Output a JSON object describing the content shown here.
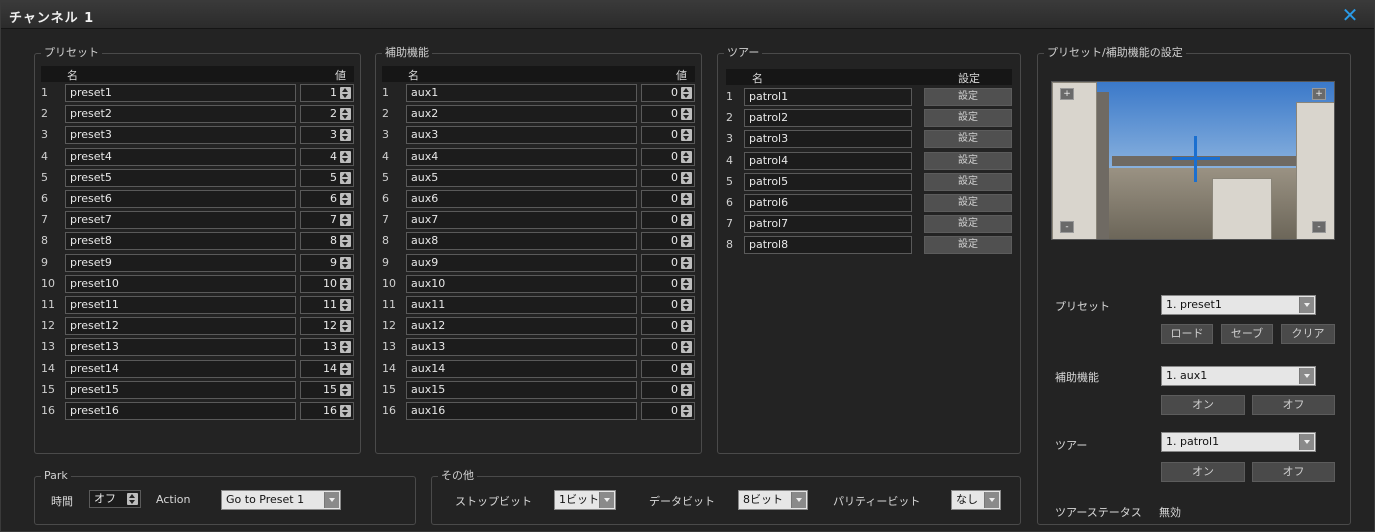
{
  "window": {
    "title": "チャンネル 1"
  },
  "preset_group": {
    "title": "プリセット",
    "header_name": "名",
    "header_value": "値",
    "rows": [
      {
        "num": "1",
        "name": "preset1",
        "value": "1"
      },
      {
        "num": "2",
        "name": "preset2",
        "value": "2"
      },
      {
        "num": "3",
        "name": "preset3",
        "value": "3"
      },
      {
        "num": "4",
        "name": "preset4",
        "value": "4"
      },
      {
        "num": "5",
        "name": "preset5",
        "value": "5"
      },
      {
        "num": "6",
        "name": "preset6",
        "value": "6"
      },
      {
        "num": "7",
        "name": "preset7",
        "value": "7"
      },
      {
        "num": "8",
        "name": "preset8",
        "value": "8"
      },
      {
        "num": "9",
        "name": "preset9",
        "value": "9"
      },
      {
        "num": "10",
        "name": "preset10",
        "value": "10"
      },
      {
        "num": "11",
        "name": "preset11",
        "value": "11"
      },
      {
        "num": "12",
        "name": "preset12",
        "value": "12"
      },
      {
        "num": "13",
        "name": "preset13",
        "value": "13"
      },
      {
        "num": "14",
        "name": "preset14",
        "value": "14"
      },
      {
        "num": "15",
        "name": "preset15",
        "value": "15"
      },
      {
        "num": "16",
        "name": "preset16",
        "value": "16"
      }
    ]
  },
  "aux_group": {
    "title": "補助機能",
    "header_name": "名",
    "header_value": "値",
    "rows": [
      {
        "num": "1",
        "name": "aux1",
        "value": "0"
      },
      {
        "num": "2",
        "name": "aux2",
        "value": "0"
      },
      {
        "num": "3",
        "name": "aux3",
        "value": "0"
      },
      {
        "num": "4",
        "name": "aux4",
        "value": "0"
      },
      {
        "num": "5",
        "name": "aux5",
        "value": "0"
      },
      {
        "num": "6",
        "name": "aux6",
        "value": "0"
      },
      {
        "num": "7",
        "name": "aux7",
        "value": "0"
      },
      {
        "num": "8",
        "name": "aux8",
        "value": "0"
      },
      {
        "num": "9",
        "name": "aux9",
        "value": "0"
      },
      {
        "num": "10",
        "name": "aux10",
        "value": "0"
      },
      {
        "num": "11",
        "name": "aux11",
        "value": "0"
      },
      {
        "num": "12",
        "name": "aux12",
        "value": "0"
      },
      {
        "num": "13",
        "name": "aux13",
        "value": "0"
      },
      {
        "num": "14",
        "name": "aux14",
        "value": "0"
      },
      {
        "num": "15",
        "name": "aux15",
        "value": "0"
      },
      {
        "num": "16",
        "name": "aux16",
        "value": "0"
      }
    ]
  },
  "tour_group": {
    "title": "ツアー",
    "header_name": "名",
    "header_setting": "設定",
    "rows": [
      {
        "num": "1",
        "name": "patrol1",
        "button": "設定"
      },
      {
        "num": "2",
        "name": "patrol2",
        "button": "設定"
      },
      {
        "num": "3",
        "name": "patrol3",
        "button": "設定"
      },
      {
        "num": "4",
        "name": "patrol4",
        "button": "設定"
      },
      {
        "num": "5",
        "name": "patrol5",
        "button": "設定"
      },
      {
        "num": "6",
        "name": "patrol6",
        "button": "設定"
      },
      {
        "num": "7",
        "name": "patrol7",
        "button": "設定"
      },
      {
        "num": "8",
        "name": "patrol8",
        "button": "設定"
      }
    ]
  },
  "settings_group": {
    "title": "プリセット/補助機能の設定",
    "camera_zoom_in": "+",
    "camera_zoom_out": "-",
    "preset_label": "プリセット",
    "preset_selected": "1. preset1",
    "load_button": "ロード",
    "save_button": "セーブ",
    "clear_button": "クリア",
    "aux_label": "補助機能",
    "aux_selected": "1. aux1",
    "aux_on_button": "オン",
    "aux_off_button": "オフ",
    "tour_label": "ツアー",
    "tour_selected": "1. patrol1",
    "tour_on_button": "オン",
    "tour_off_button": "オフ",
    "tour_status_label": "ツアーステータス",
    "tour_status_value": "無効"
  },
  "park_group": {
    "title": "Park",
    "time_label": "時間",
    "time_value": "オフ",
    "action_label": "Action",
    "action_selected": "Go to Preset 1"
  },
  "other_group": {
    "title": "その他",
    "stop_bit_label": "ストップビット",
    "stop_bit_value": "1ビット",
    "data_bit_label": "データビット",
    "data_bit_value": "8ビット",
    "parity_label": "パリティービット",
    "parity_value": "なし"
  },
  "colors": {
    "close_icon": "#2a9be8",
    "panel_bg": "#232323",
    "field_bg": "#1c1c1c",
    "select_bg": "#e6e6e6"
  }
}
